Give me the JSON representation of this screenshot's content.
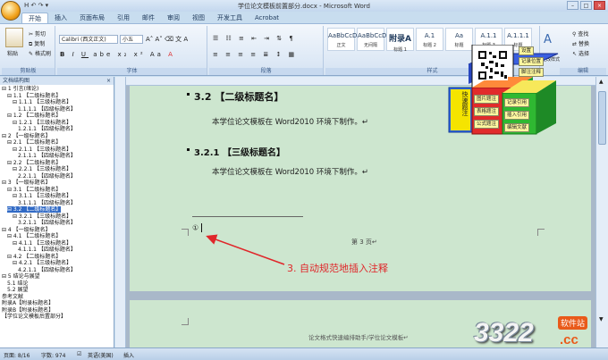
{
  "window": {
    "title": "学位论文模板前置部分.docx - Microsoft Word"
  },
  "qat": "H ↶ ↷ ▾",
  "tabs": [
    "开始",
    "插入",
    "页面布局",
    "引用",
    "邮件",
    "审阅",
    "视图",
    "开发工具",
    "Acrobat"
  ],
  "ribbon": {
    "paste": "粘贴",
    "cut": "剪切",
    "copy": "复制",
    "format_painter": "格式刷",
    "clipboard_label": "剪贴板",
    "font_name": "Calibri (西文正文)",
    "font_size": "小五",
    "font_label": "字体",
    "paragraph_label": "段落",
    "styles_label": "样式",
    "editing_label": "编辑",
    "find": "查找",
    "replace": "替换",
    "select": "选择",
    "change_styles": "更改样式",
    "styles": [
      {
        "sample": "AaBbCcD",
        "name": "正文"
      },
      {
        "sample": "AaBbCcD",
        "name": "无间隔"
      },
      {
        "sample": "附录A",
        "name": "标题 1"
      },
      {
        "sample": "A.1",
        "name": "标题 2"
      },
      {
        "sample": "Aa",
        "name": "标题"
      },
      {
        "sample": "A.1.1",
        "name": "标题 3"
      },
      {
        "sample": "A.1.1.1",
        "name": "标题"
      }
    ]
  },
  "nav": {
    "title": "文档结构图",
    "items": [
      {
        "text": "⊟ 1 引言(绪论)",
        "indent": 0
      },
      {
        "text": "⊟ 1.1 【二级标题名】",
        "indent": 1
      },
      {
        "text": "⊟ 1.1.1 【三级标题名】",
        "indent": 2
      },
      {
        "text": "1.1.1.1 【四级标题名】",
        "indent": 3
      },
      {
        "text": "⊟ 1.2 【二级标题名】",
        "indent": 1
      },
      {
        "text": "⊟ 1.2.1 【三级标题名】",
        "indent": 2
      },
      {
        "text": "1.2.1.1 【四级标题名】",
        "indent": 3
      },
      {
        "text": "⊟ 2 【一级标题名】",
        "indent": 0
      },
      {
        "text": "⊟ 2.1 【二级标题名】",
        "indent": 1
      },
      {
        "text": "⊟ 2.1.1 【三级标题名】",
        "indent": 2
      },
      {
        "text": "2.1.1.1 【四级标题名】",
        "indent": 3
      },
      {
        "text": "⊟ 2.2 【二级标题名】",
        "indent": 1
      },
      {
        "text": "⊟ 2.2.1 【三级标题名】",
        "indent": 2
      },
      {
        "text": "2.2.1.1 【四级标题名】",
        "indent": 3
      },
      {
        "text": "⊟ 3 【一级标题名】",
        "indent": 0
      },
      {
        "text": "⊟ 3.1 【二级标题名】",
        "indent": 1
      },
      {
        "text": "⊟ 3.1.1 【三级标题名】",
        "indent": 2
      },
      {
        "text": "3.1.1.1 【四级标题名】",
        "indent": 3
      },
      {
        "text": "⊟ 3.2 【二级标题名】",
        "indent": 1,
        "selected": true
      },
      {
        "text": "⊟ 3.2.1 【三级标题名】",
        "indent": 2
      },
      {
        "text": "3.2.1.1 【四级标题名】",
        "indent": 3
      },
      {
        "text": "⊟ 4 【一级标题名】",
        "indent": 0
      },
      {
        "text": "⊟ 4.1 【二级标题名】",
        "indent": 1
      },
      {
        "text": "⊟ 4.1.1 【三级标题名】",
        "indent": 2
      },
      {
        "text": "4.1.1.1 【四级标题名】",
        "indent": 3
      },
      {
        "text": "⊟ 4.2 【二级标题名】",
        "indent": 1
      },
      {
        "text": "⊟ 4.2.1 【三级标题名】",
        "indent": 2
      },
      {
        "text": "4.2.1.1 【四级标题名】",
        "indent": 3
      },
      {
        "text": "⊟ 5 结论与展望",
        "indent": 0
      },
      {
        "text": "5.1 结论",
        "indent": 1
      },
      {
        "text": "5.2 展望",
        "indent": 1
      },
      {
        "text": "参考文献",
        "indent": 0
      },
      {
        "text": "附录A【附录标题名】",
        "indent": 0
      },
      {
        "text": "附录B【附录标题名】",
        "indent": 0
      },
      {
        "text": "【学位论文模板后置部分】",
        "indent": 0
      }
    ]
  },
  "doc": {
    "h2": "3.2  【二级标题名】",
    "p1": "本学位论文模板在 Word2010 环境下制作。↵",
    "h3": "3.2.1  【三级标题名】",
    "p2": "本学位论文模板在 Word2010 环境下制作。↵",
    "footnote_mark": "①",
    "page_label": "第 3 页↵",
    "page2_header": "论文格式快速编排助手/学位论文模板↵"
  },
  "toolbox": {
    "vertical": "快速题注",
    "items": [
      "设置",
      "记录位置",
      "脚注注释",
      "图片题注",
      "表格题注",
      "公式题注",
      "记录引用",
      "插入引用",
      "编辑文献"
    ]
  },
  "callout": {
    "text": "3. 自动规范地插入注释"
  },
  "status": {
    "page": "页面: 8/16",
    "words": "字数: 974",
    "lang": "英语(美国)",
    "insert": "插入"
  },
  "watermark": {
    "number": "3322",
    "domain": ".cc",
    "site": "软件站"
  },
  "colors": {
    "page": "#cde6cf",
    "accent": "#e0262a",
    "selection": "#316ac5"
  }
}
